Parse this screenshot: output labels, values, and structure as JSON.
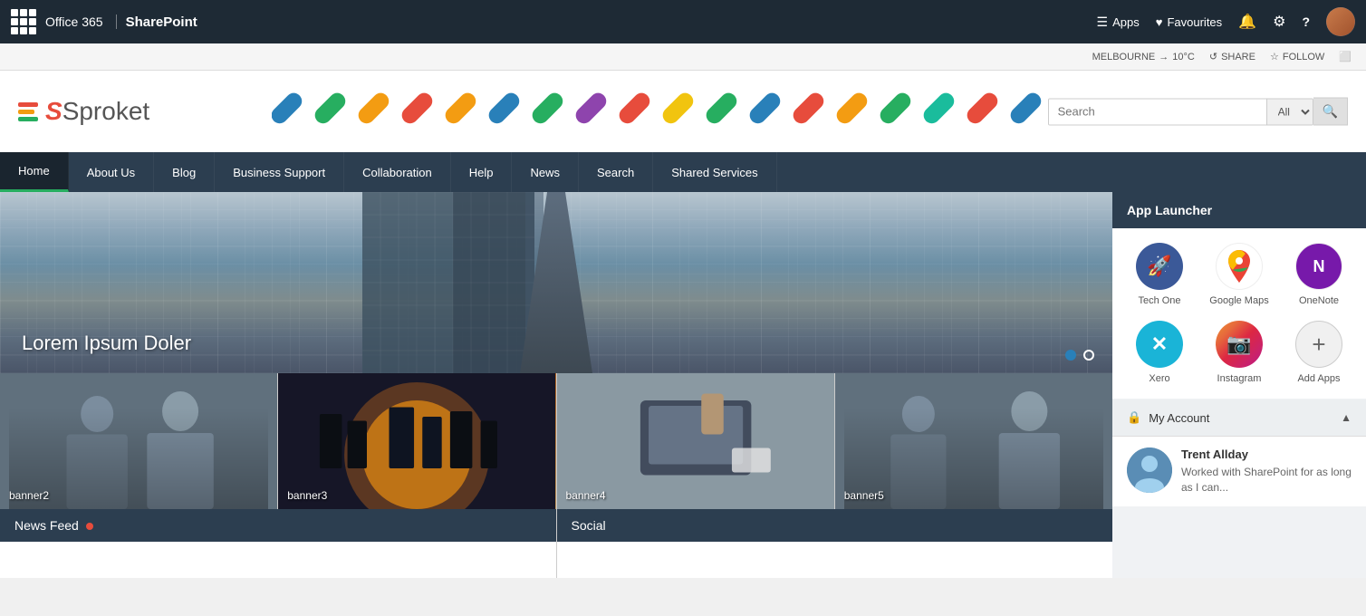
{
  "topbar": {
    "office365": "Office 365",
    "sharepoint": "SharePoint",
    "apps": "Apps",
    "favourites": "Favourites"
  },
  "breadcrumb": {
    "location": "MELBOURNE",
    "temperature": "10°C",
    "share": "SHARE",
    "follow": "FOLLOW"
  },
  "logo": {
    "text": "Sproket"
  },
  "search": {
    "placeholder": "Search",
    "scope": "All ▾",
    "button": "🔍"
  },
  "nav": {
    "items": [
      {
        "label": "Home",
        "active": true
      },
      {
        "label": "About Us",
        "active": false
      },
      {
        "label": "Blog",
        "active": false
      },
      {
        "label": "Business Support",
        "active": false
      },
      {
        "label": "Collaboration",
        "active": false
      },
      {
        "label": "Help",
        "active": false
      },
      {
        "label": "News",
        "active": false
      },
      {
        "label": "Search",
        "active": false
      },
      {
        "label": "Shared Services",
        "active": false
      }
    ]
  },
  "hero": {
    "text": "Lorem Ipsum Doler"
  },
  "banners": [
    {
      "label": "banner2",
      "class": "b2"
    },
    {
      "label": "banner3",
      "class": "b3"
    },
    {
      "label": "banner4",
      "class": "b4"
    },
    {
      "label": "banner5",
      "class": "b5"
    }
  ],
  "sections": [
    {
      "title": "News Feed",
      "hasDot": true,
      "id": "news-feed"
    },
    {
      "title": "Social",
      "hasDot": false,
      "id": "social"
    }
  ],
  "sidebar": {
    "appLauncher": {
      "title": "App Launcher",
      "apps": [
        {
          "label": "Tech One",
          "icon": "🚀",
          "iconClass": "app-icon-tech"
        },
        {
          "label": "Google Maps",
          "icon": "📍",
          "iconClass": "app-icon-gmaps"
        },
        {
          "label": "OneNote",
          "icon": "📓",
          "iconClass": "app-icon-onenote"
        },
        {
          "label": "Xero",
          "icon": "✕",
          "iconClass": "app-icon-xero"
        },
        {
          "label": "Instagram",
          "icon": "📷",
          "iconClass": "app-icon-instagram"
        },
        {
          "label": "Add Apps",
          "icon": "+",
          "iconClass": "app-icon-add"
        }
      ]
    },
    "myAccount": {
      "title": "My Account",
      "userName": "Trent Allday",
      "userDesc": "Worked with SharePoint for as long as I can..."
    }
  },
  "icons": {
    "waffle": "⋮⋮⋮",
    "apps_icon": "☰",
    "heart": "♥",
    "bell": "🔔",
    "gear": "⚙",
    "question": "?",
    "share_icon": "↺",
    "star": "☆",
    "expand": "⬜",
    "lock": "🔒",
    "chevron_up": "▲",
    "chevron_down": "▾"
  }
}
